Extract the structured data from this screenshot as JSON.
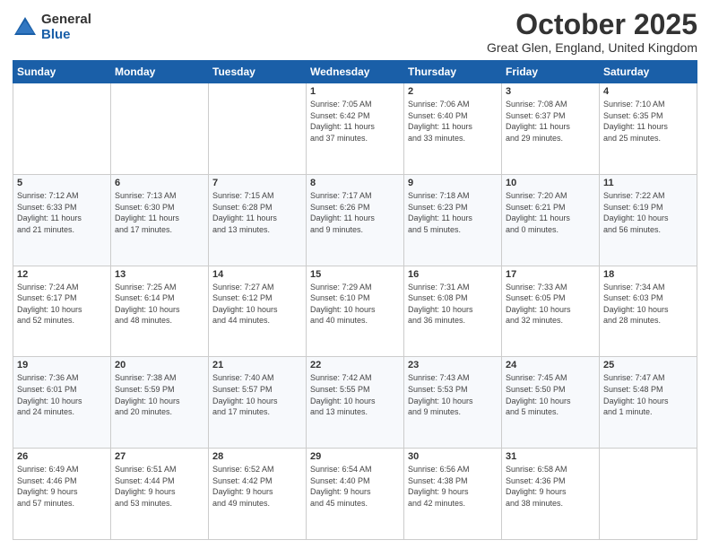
{
  "logo": {
    "general": "General",
    "blue": "Blue"
  },
  "header": {
    "month": "October 2025",
    "location": "Great Glen, England, United Kingdom"
  },
  "weekdays": [
    "Sunday",
    "Monday",
    "Tuesday",
    "Wednesday",
    "Thursday",
    "Friday",
    "Saturday"
  ],
  "weeks": [
    [
      {
        "day": "",
        "info": ""
      },
      {
        "day": "",
        "info": ""
      },
      {
        "day": "",
        "info": ""
      },
      {
        "day": "1",
        "info": "Sunrise: 7:05 AM\nSunset: 6:42 PM\nDaylight: 11 hours\nand 37 minutes."
      },
      {
        "day": "2",
        "info": "Sunrise: 7:06 AM\nSunset: 6:40 PM\nDaylight: 11 hours\nand 33 minutes."
      },
      {
        "day": "3",
        "info": "Sunrise: 7:08 AM\nSunset: 6:37 PM\nDaylight: 11 hours\nand 29 minutes."
      },
      {
        "day": "4",
        "info": "Sunrise: 7:10 AM\nSunset: 6:35 PM\nDaylight: 11 hours\nand 25 minutes."
      }
    ],
    [
      {
        "day": "5",
        "info": "Sunrise: 7:12 AM\nSunset: 6:33 PM\nDaylight: 11 hours\nand 21 minutes."
      },
      {
        "day": "6",
        "info": "Sunrise: 7:13 AM\nSunset: 6:30 PM\nDaylight: 11 hours\nand 17 minutes."
      },
      {
        "day": "7",
        "info": "Sunrise: 7:15 AM\nSunset: 6:28 PM\nDaylight: 11 hours\nand 13 minutes."
      },
      {
        "day": "8",
        "info": "Sunrise: 7:17 AM\nSunset: 6:26 PM\nDaylight: 11 hours\nand 9 minutes."
      },
      {
        "day": "9",
        "info": "Sunrise: 7:18 AM\nSunset: 6:23 PM\nDaylight: 11 hours\nand 5 minutes."
      },
      {
        "day": "10",
        "info": "Sunrise: 7:20 AM\nSunset: 6:21 PM\nDaylight: 11 hours\nand 0 minutes."
      },
      {
        "day": "11",
        "info": "Sunrise: 7:22 AM\nSunset: 6:19 PM\nDaylight: 10 hours\nand 56 minutes."
      }
    ],
    [
      {
        "day": "12",
        "info": "Sunrise: 7:24 AM\nSunset: 6:17 PM\nDaylight: 10 hours\nand 52 minutes."
      },
      {
        "day": "13",
        "info": "Sunrise: 7:25 AM\nSunset: 6:14 PM\nDaylight: 10 hours\nand 48 minutes."
      },
      {
        "day": "14",
        "info": "Sunrise: 7:27 AM\nSunset: 6:12 PM\nDaylight: 10 hours\nand 44 minutes."
      },
      {
        "day": "15",
        "info": "Sunrise: 7:29 AM\nSunset: 6:10 PM\nDaylight: 10 hours\nand 40 minutes."
      },
      {
        "day": "16",
        "info": "Sunrise: 7:31 AM\nSunset: 6:08 PM\nDaylight: 10 hours\nand 36 minutes."
      },
      {
        "day": "17",
        "info": "Sunrise: 7:33 AM\nSunset: 6:05 PM\nDaylight: 10 hours\nand 32 minutes."
      },
      {
        "day": "18",
        "info": "Sunrise: 7:34 AM\nSunset: 6:03 PM\nDaylight: 10 hours\nand 28 minutes."
      }
    ],
    [
      {
        "day": "19",
        "info": "Sunrise: 7:36 AM\nSunset: 6:01 PM\nDaylight: 10 hours\nand 24 minutes."
      },
      {
        "day": "20",
        "info": "Sunrise: 7:38 AM\nSunset: 5:59 PM\nDaylight: 10 hours\nand 20 minutes."
      },
      {
        "day": "21",
        "info": "Sunrise: 7:40 AM\nSunset: 5:57 PM\nDaylight: 10 hours\nand 17 minutes."
      },
      {
        "day": "22",
        "info": "Sunrise: 7:42 AM\nSunset: 5:55 PM\nDaylight: 10 hours\nand 13 minutes."
      },
      {
        "day": "23",
        "info": "Sunrise: 7:43 AM\nSunset: 5:53 PM\nDaylight: 10 hours\nand 9 minutes."
      },
      {
        "day": "24",
        "info": "Sunrise: 7:45 AM\nSunset: 5:50 PM\nDaylight: 10 hours\nand 5 minutes."
      },
      {
        "day": "25",
        "info": "Sunrise: 7:47 AM\nSunset: 5:48 PM\nDaylight: 10 hours\nand 1 minute."
      }
    ],
    [
      {
        "day": "26",
        "info": "Sunrise: 6:49 AM\nSunset: 4:46 PM\nDaylight: 9 hours\nand 57 minutes."
      },
      {
        "day": "27",
        "info": "Sunrise: 6:51 AM\nSunset: 4:44 PM\nDaylight: 9 hours\nand 53 minutes."
      },
      {
        "day": "28",
        "info": "Sunrise: 6:52 AM\nSunset: 4:42 PM\nDaylight: 9 hours\nand 49 minutes."
      },
      {
        "day": "29",
        "info": "Sunrise: 6:54 AM\nSunset: 4:40 PM\nDaylight: 9 hours\nand 45 minutes."
      },
      {
        "day": "30",
        "info": "Sunrise: 6:56 AM\nSunset: 4:38 PM\nDaylight: 9 hours\nand 42 minutes."
      },
      {
        "day": "31",
        "info": "Sunrise: 6:58 AM\nSunset: 4:36 PM\nDaylight: 9 hours\nand 38 minutes."
      },
      {
        "day": "",
        "info": ""
      }
    ]
  ]
}
